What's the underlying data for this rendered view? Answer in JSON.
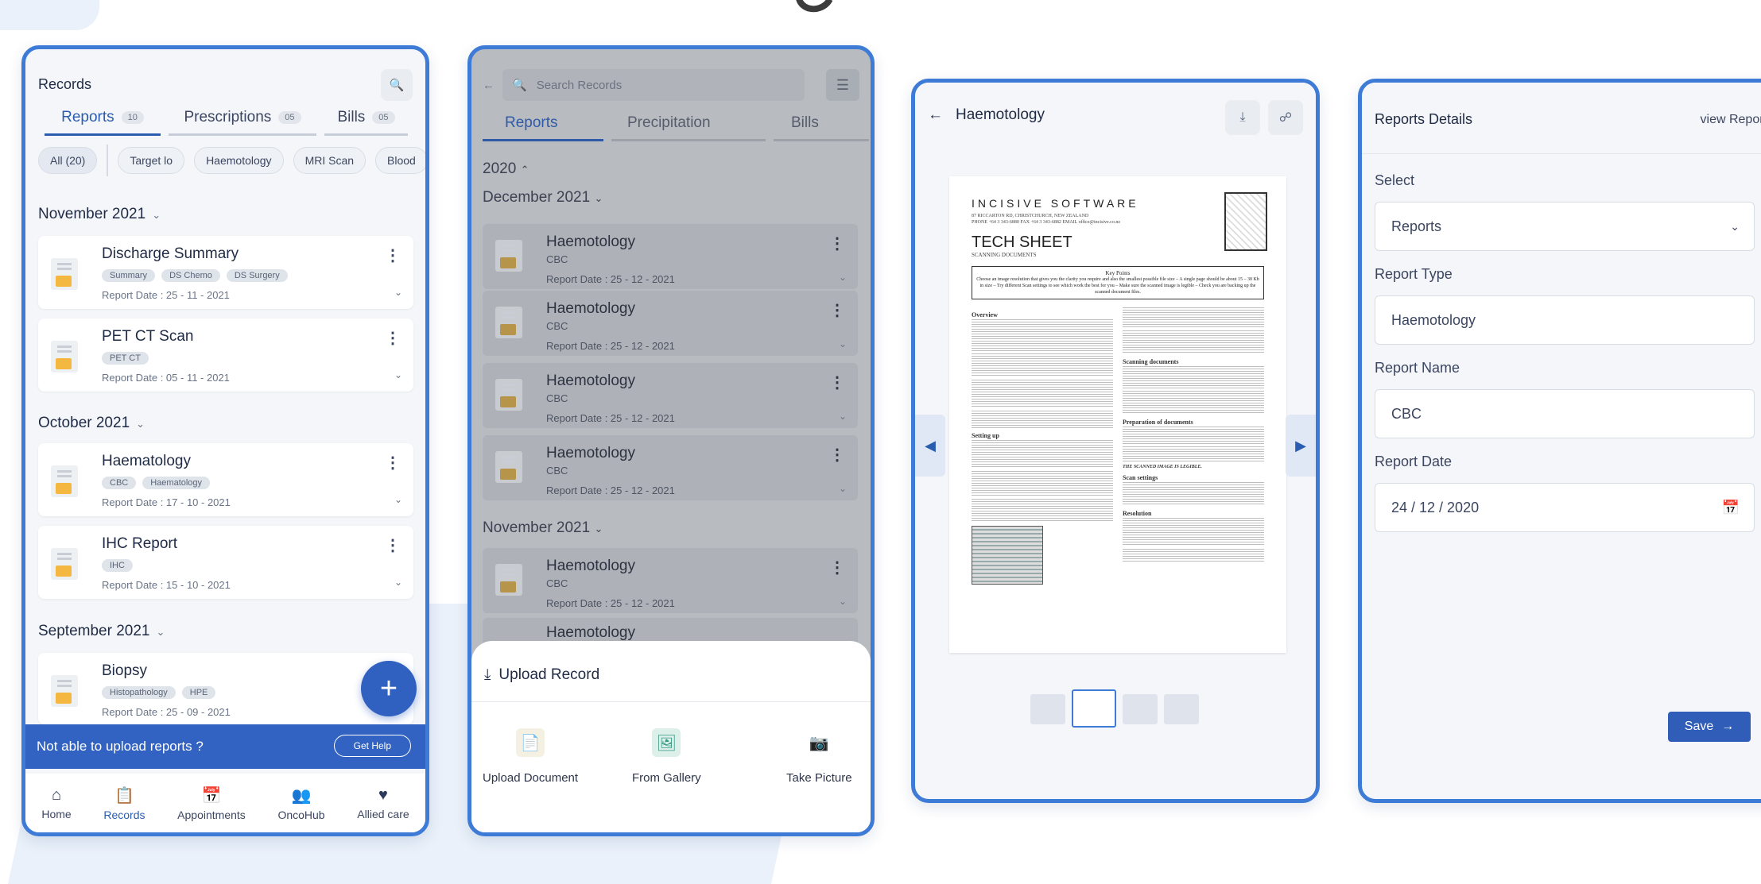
{
  "screen1": {
    "title": "Records",
    "tabs": [
      {
        "label": "Reports",
        "count": "10"
      },
      {
        "label": "Prescriptions",
        "count": "05"
      },
      {
        "label": "Bills",
        "count": "05"
      }
    ],
    "chips": [
      "All (20)",
      "Target lo",
      "Haemotology",
      "MRI Scan",
      "Blood"
    ],
    "groups": [
      {
        "month": "November 2021",
        "records": [
          {
            "title": "Discharge Summary",
            "tags": [
              "Summary",
              "DS Chemo",
              "DS Surgery"
            ],
            "date": "Report Date : 25 - 11 - 2021"
          },
          {
            "title": "PET CT Scan",
            "tags": [
              "PET CT"
            ],
            "date": "Report Date : 05 - 11 - 2021"
          }
        ]
      },
      {
        "month": "October 2021",
        "records": [
          {
            "title": "Haematology",
            "tags": [
              "CBC",
              "Haematology"
            ],
            "date": "Report Date : 17 - 10 - 2021"
          },
          {
            "title": "IHC Report",
            "tags": [
              "IHC"
            ],
            "date": "Report Date : 15 - 10 - 2021"
          }
        ]
      },
      {
        "month": "September 2021",
        "records": [
          {
            "title": "Biopsy",
            "tags": [
              "Histopathology",
              "HPE"
            ],
            "date": "Report Date : 25 - 09 - 2021"
          }
        ]
      }
    ],
    "help": {
      "text": "Not able to upload reports ?",
      "button": "Get Help"
    },
    "nav": [
      "Home",
      "Records",
      "Appointments",
      "OncoHub",
      "Allied care"
    ]
  },
  "screen2": {
    "search_placeholder": "Search Records",
    "tabs": [
      "Reports",
      "Precipitation",
      "Bills"
    ],
    "year": "2020",
    "groups": [
      {
        "month": "December 2021",
        "records": [
          {
            "title": "Haemotology",
            "sub": "CBC",
            "date": "Report Date : 25 - 12 - 2021"
          },
          {
            "title": "Haemotology",
            "sub": "CBC",
            "date": "Report Date : 25 - 12 - 2021"
          },
          {
            "title": "Haemotology",
            "sub": "CBC",
            "date": "Report Date : 25 - 12 - 2021"
          },
          {
            "title": "Haemotology",
            "sub": "CBC",
            "date": "Report Date : 25 - 12 - 2021"
          }
        ]
      },
      {
        "month": "November 2021",
        "records": [
          {
            "title": "Haemotology",
            "sub": "CBC",
            "date": "Report Date : 25 - 12 - 2021"
          },
          {
            "title": "Haemotology"
          }
        ]
      }
    ],
    "sheet": {
      "title": "Upload Record",
      "options": [
        "Upload Document",
        "From Gallery",
        "Take Picture"
      ]
    }
  },
  "screen3": {
    "title": "Haemotology",
    "doc": {
      "company": "INCISIVE SOFTWARE",
      "address": "87 RICCARTON RD, CHRISTCHURCH, NEW ZEALAND",
      "contact": "PHONE +64 3 343-6880  FAX +64 3 343-6882  EMAIL office@incisive.co.nz",
      "heading": "TECH SHEET",
      "subheading": "SCANNING DOCUMENTS",
      "keypoints_title": "Key Points",
      "keypoints": "Choose an image resolution that gives you the clarity you require and also the smallest possible file size – A single page should be about 15 – 30 Kb in size – Try different Scan settings to see which work the best for you – Make sure the scanned image is legible – Check you are backing up the scanned document files.",
      "sections_left": [
        "Overview",
        "Setting up"
      ],
      "sections_right": [
        "Scanning documents",
        "Preparation of documents",
        "Scan settings",
        "Resolution"
      ],
      "caution": "THE SCANNED IMAGE IS LEGIBLE."
    }
  },
  "screen4": {
    "title": "Reports Details",
    "view_link": "view Report",
    "fields": [
      {
        "label": "Select",
        "value": "Reports"
      },
      {
        "label": "Report Type",
        "value": "Haemotology"
      },
      {
        "label": "Report Name",
        "value": "CBC"
      },
      {
        "label": "Report Date",
        "value": "24 / 12 / 2020"
      }
    ],
    "save": "Save"
  }
}
